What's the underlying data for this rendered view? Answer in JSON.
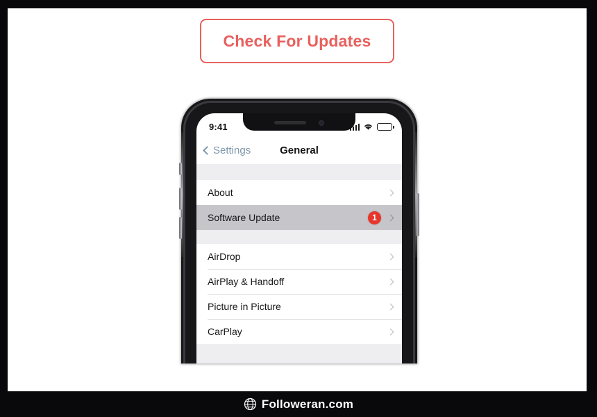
{
  "banner": {
    "title": "Check For Updates",
    "border_color": "#e8615e",
    "text_color": "#e8605d"
  },
  "phone": {
    "status_bar": {
      "time": "9:41",
      "signal_icon": "cellular-signal-icon",
      "wifi_icon": "wifi-icon",
      "battery_icon": "battery-icon"
    },
    "nav_bar": {
      "back_label": "Settings",
      "back_icon": "chevron-left-icon",
      "title": "General"
    },
    "groups": [
      {
        "rows": [
          {
            "label": "About",
            "badge": null,
            "selected": false
          },
          {
            "label": "Software Update",
            "badge": "1",
            "selected": true
          }
        ]
      },
      {
        "rows": [
          {
            "label": "AirDrop",
            "badge": null,
            "selected": false
          },
          {
            "label": "AirPlay & Handoff",
            "badge": null,
            "selected": false
          },
          {
            "label": "Picture in Picture",
            "badge": null,
            "selected": false
          },
          {
            "label": "CarPlay",
            "badge": null,
            "selected": false
          }
        ]
      }
    ],
    "badge_color": "#e8352c",
    "selected_row_color": "#c6c6ca",
    "accent_color": "#7d97ab"
  },
  "footer": {
    "icon": "globe-icon",
    "text": "Followeran.com"
  }
}
